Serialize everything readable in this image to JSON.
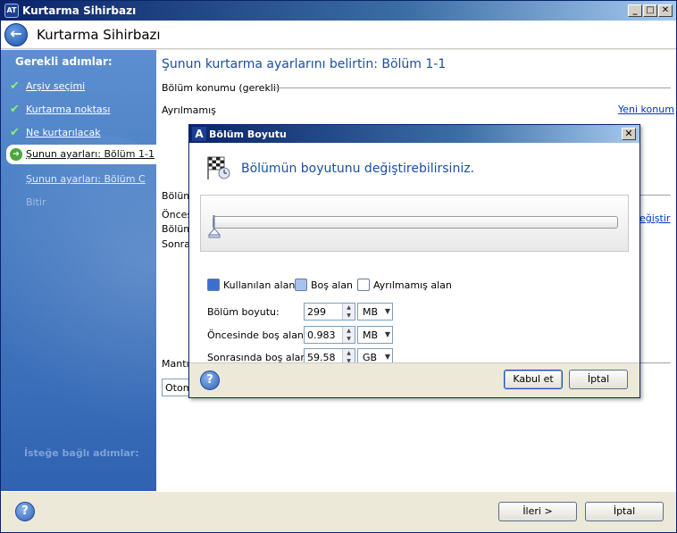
{
  "window": {
    "title": "Kurtarma Sihirbazı",
    "controls": [
      "_",
      "□",
      "✕"
    ]
  },
  "header": {
    "title": "Kurtarma Sihirbazı"
  },
  "sidebar": {
    "heading": "Gerekli adımlar:",
    "items": [
      {
        "label": "Arşiv seçimi",
        "state": "done"
      },
      {
        "label": "Kurtarma noktası",
        "state": "done"
      },
      {
        "label": "Ne kurtarılacak",
        "state": "done"
      },
      {
        "label": "Şunun ayarları: Bölüm 1-1",
        "state": "active"
      },
      {
        "label": "Şunun ayarları: Bölüm C",
        "state": "pending"
      },
      {
        "label": "Bitir",
        "state": "disabled"
      }
    ],
    "optional_heading": "İsteğe bağlı adımlar:"
  },
  "content": {
    "title": "Şunun kurtarma ayarlarını belirtin: Bölüm 1-1",
    "location_group": "Bölüm konumu (gerekli)",
    "location_value": "Ayrılmamış",
    "new_location_link": "Yeni konum",
    "partial_group": "Bölüm",
    "partial_lines": [
      "Öncesi",
      "Bölüm",
      "Sonra"
    ],
    "change_link": "değiştir",
    "logical_group": "Mantık",
    "combo_value": "Otomatik"
  },
  "footer": {
    "help": "?",
    "next": "İleri >",
    "cancel": "İptal"
  },
  "dialog": {
    "title": "Bölüm Boyutu",
    "close": "✕",
    "heading": "Bölümün boyutunu değiştirebilirsiniz.",
    "slider_level": 0.0,
    "legend": [
      {
        "label": "Kullanılan alan",
        "color": "#3b6fd1"
      },
      {
        "label": "Boş alan",
        "color": "#a6c3ee"
      },
      {
        "label": "Ayrılmamış alan",
        "color": "#ffffff"
      }
    ],
    "fields": [
      {
        "label": "Bölüm boyutu:",
        "value": "299",
        "unit": "MB"
      },
      {
        "label": "Öncesinde boş alan:",
        "value": "0.983",
        "unit": "MB"
      },
      {
        "label": "Sonrasında boş alan:",
        "value": "59.58",
        "unit": "GB"
      }
    ],
    "ok": "Kabul et",
    "cancel": "İptal",
    "help": "?"
  }
}
